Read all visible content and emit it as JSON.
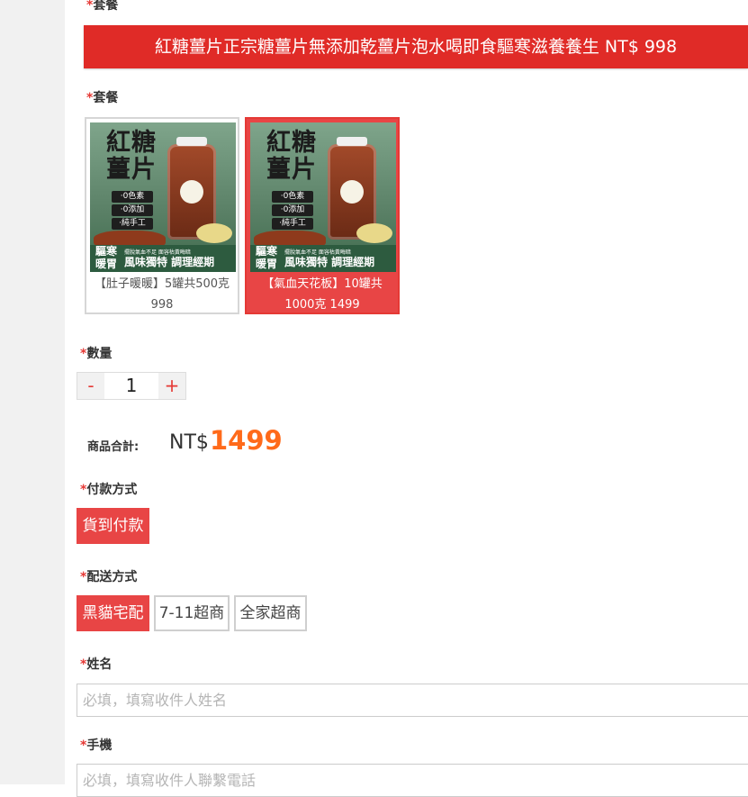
{
  "labels": {
    "package_top": "套餐",
    "package": "套餐",
    "quantity": "數量",
    "payment": "付款方式",
    "shipping": "配送方式",
    "name": "姓名",
    "phone": "手機",
    "required_mark": "*"
  },
  "banner": {
    "text": "紅糖薑片正宗糖薑片無添加乾薑片泡水喝即食驅寒滋養養生 NT$ 998"
  },
  "packages": [
    {
      "title_line1": "【肚子暖暖】5罐共500克",
      "title_line2": "998",
      "selected": false,
      "image": {
        "title": "紅糖\n薑片",
        "tags": [
          "·0色素",
          "·0添加",
          "·純手工"
        ],
        "left_text": "驅寒\n暖胃",
        "right_text": "風味獨特 調理經期",
        "small_text": "擺脫氣血不足 面容枯黃晦暗"
      }
    },
    {
      "title_line1": "【氣血天花板】10罐共",
      "title_line2": "1000克 1499",
      "selected": true,
      "image": {
        "title": "紅糖\n薑片",
        "tags": [
          "·0色素",
          "·0添加",
          "·純手工"
        ],
        "left_text": "驅寒\n暖胃",
        "right_text": "風味獨特 調理經期",
        "small_text": "擺脫氣血不足 面容枯黃晦暗"
      }
    }
  ],
  "quantity": {
    "minus": "-",
    "value": "1",
    "plus": "+"
  },
  "total": {
    "label": "商品合計:",
    "currency": "NT$",
    "amount": "1499"
  },
  "payment_options": [
    {
      "label": "貨到付款",
      "selected": true
    }
  ],
  "shipping_options": [
    {
      "label": "黑貓宅配",
      "selected": true
    },
    {
      "label": "7-11超商",
      "selected": false
    },
    {
      "label": "全家超商",
      "selected": false
    }
  ],
  "inputs": {
    "name_placeholder": "必填，填寫收件人姓名",
    "phone_placeholder": "必填，填寫收件人聯繫電話"
  },
  "colors": {
    "accent": "#e84545",
    "banner": "#e02b27",
    "price": "#ff6a1a"
  }
}
